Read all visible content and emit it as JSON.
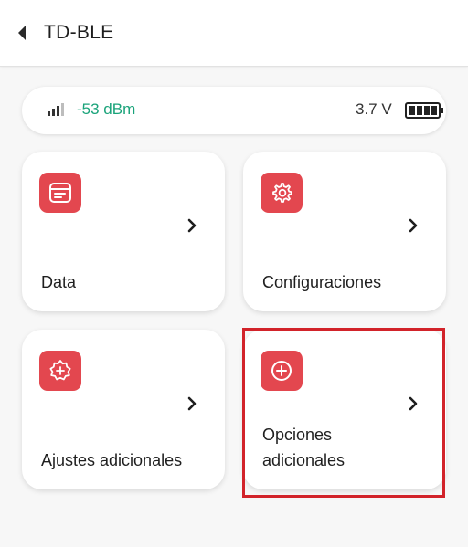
{
  "header": {
    "title": "TD-BLE",
    "back_icon": "chevron-left-icon"
  },
  "status": {
    "signal": "-53 dBm",
    "voltage": "3.7 V",
    "signal_color": "#1aa37a"
  },
  "cards": [
    {
      "label": "Data",
      "icon": "document-icon"
    },
    {
      "label": "Configuraciones",
      "icon": "gear-icon"
    },
    {
      "label": "Ajustes adicionales",
      "icon": "settings-badge-icon"
    },
    {
      "label": "Opciones adicionales",
      "icon": "plus-circle-icon"
    }
  ],
  "colors": {
    "accent": "#e3474f",
    "highlight": "#d2232a"
  }
}
